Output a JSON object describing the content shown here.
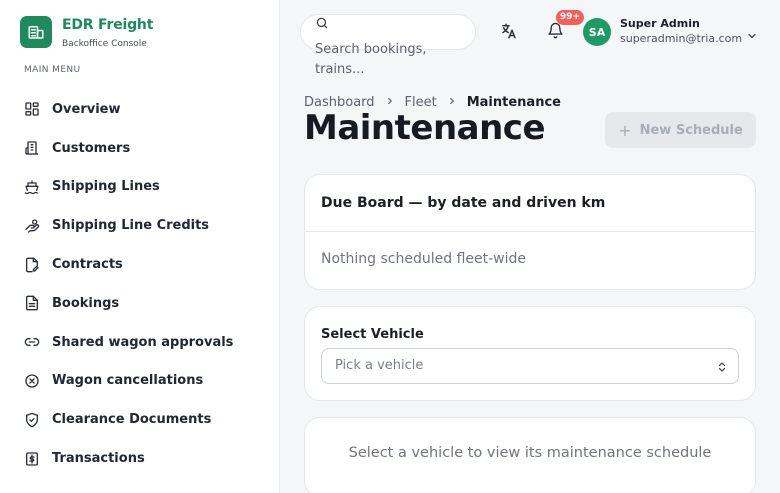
{
  "brand": {
    "name": "EDR Freight",
    "subtitle": "Backoffice Console",
    "icon": "building-icon",
    "accent": "#1e8a5e"
  },
  "sidebar": {
    "heading": "MAIN MENU",
    "items": [
      {
        "label": "Overview",
        "icon": "grid-icon"
      },
      {
        "label": "Customers",
        "icon": "buildings-icon"
      },
      {
        "label": "Shipping Lines",
        "icon": "ship-icon"
      },
      {
        "label": "Shipping Line Credits",
        "icon": "hand-coins-icon"
      },
      {
        "label": "Contracts",
        "icon": "file-signature-icon"
      },
      {
        "label": "Bookings",
        "icon": "document-icon"
      },
      {
        "label": "Shared wagon approvals",
        "icon": "link-icon"
      },
      {
        "label": "Wagon cancellations",
        "icon": "x-circle-icon"
      },
      {
        "label": "Clearance Documents",
        "icon": "shield-check-icon"
      },
      {
        "label": "Transactions",
        "icon": "dollar-receipt-icon"
      }
    ]
  },
  "header": {
    "search_placeholder": "Search bookings, trains...",
    "notifications_count": "99+",
    "user": {
      "initials": "SA",
      "name": "Super Admin",
      "email": "superadmin@tria.com"
    }
  },
  "breadcrumb": {
    "items": [
      "Dashboard",
      "Fleet"
    ],
    "current": "Maintenance"
  },
  "page": {
    "title": "Maintenance",
    "new_button": "New Schedule"
  },
  "due_board": {
    "title": "Due Board — by date and driven km",
    "empty": "Nothing scheduled fleet-wide"
  },
  "vehicle_select": {
    "label": "Select Vehicle",
    "placeholder": "Pick a vehicle"
  },
  "schedule": {
    "empty": "Select a vehicle to view its maintenance schedule"
  },
  "colors": {
    "avatar": "#1e9b64",
    "badge": "#f0605d",
    "disabled_button": "#e6e8ec"
  }
}
